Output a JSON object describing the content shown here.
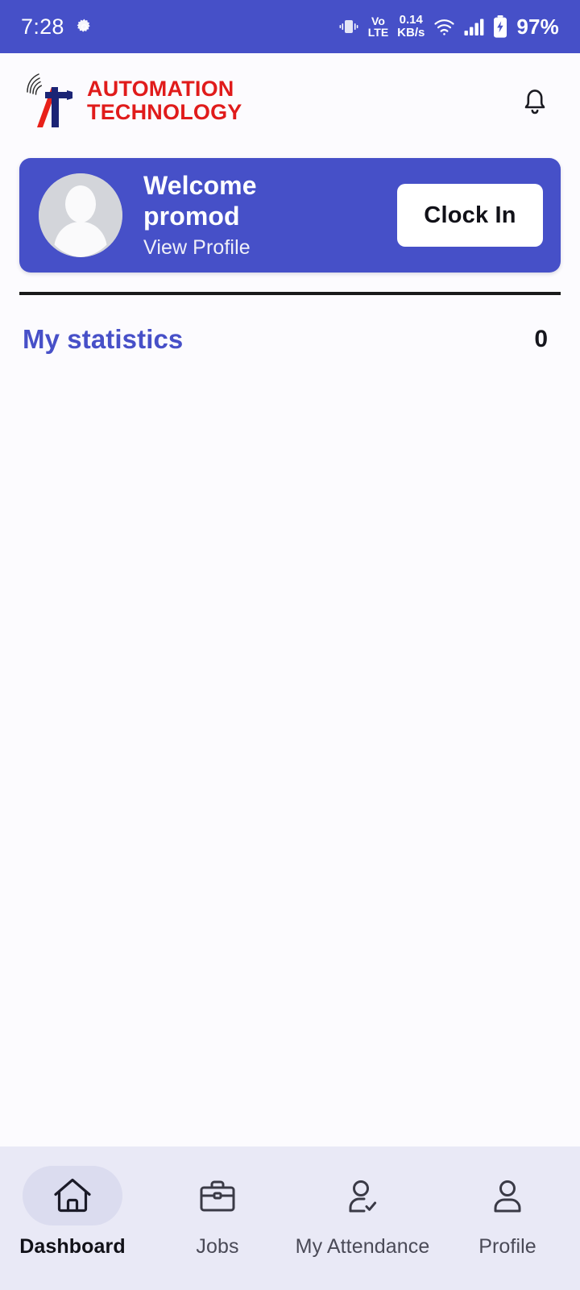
{
  "status_bar": {
    "time": "7:28",
    "gear_icon": "gear-icon",
    "vibrate_icon": "vibrate-icon",
    "volte_line1": "Vo",
    "volte_line2": "LTE",
    "net_speed_value": "0.14",
    "net_speed_unit": "KB/s",
    "wifi_icon": "wifi-icon",
    "signal_icon": "cellular-signal-icon",
    "battery_icon": "battery-charging-icon",
    "battery_percent": "97%",
    "background_color": "#4650C8"
  },
  "header": {
    "logo_icon": "automation-technology-logo-icon",
    "brand_line1": "AUTOMATION",
    "brand_line2": "TECHNOLOGY",
    "brand_color": "#E01B1B",
    "notification_icon": "bell-icon"
  },
  "welcome_card": {
    "avatar_icon": "user-avatar-icon",
    "greeting": "Welcome promod",
    "view_profile_label": "View Profile",
    "clock_in_label": "Clock In",
    "accent_color": "#4650C8"
  },
  "statistics": {
    "title": "My statistics",
    "value": "0",
    "title_color": "#4750C8"
  },
  "bottom_nav": {
    "items": [
      {
        "label": "Dashboard",
        "icon": "home-icon",
        "active": true
      },
      {
        "label": "Jobs",
        "icon": "briefcase-icon",
        "active": false
      },
      {
        "label": "My Attendance",
        "icon": "user-check-icon",
        "active": false
      },
      {
        "label": "Profile",
        "icon": "person-icon",
        "active": false
      }
    ],
    "background_color": "#E9E9F6",
    "active_pill_color": "#DBDCEF"
  }
}
